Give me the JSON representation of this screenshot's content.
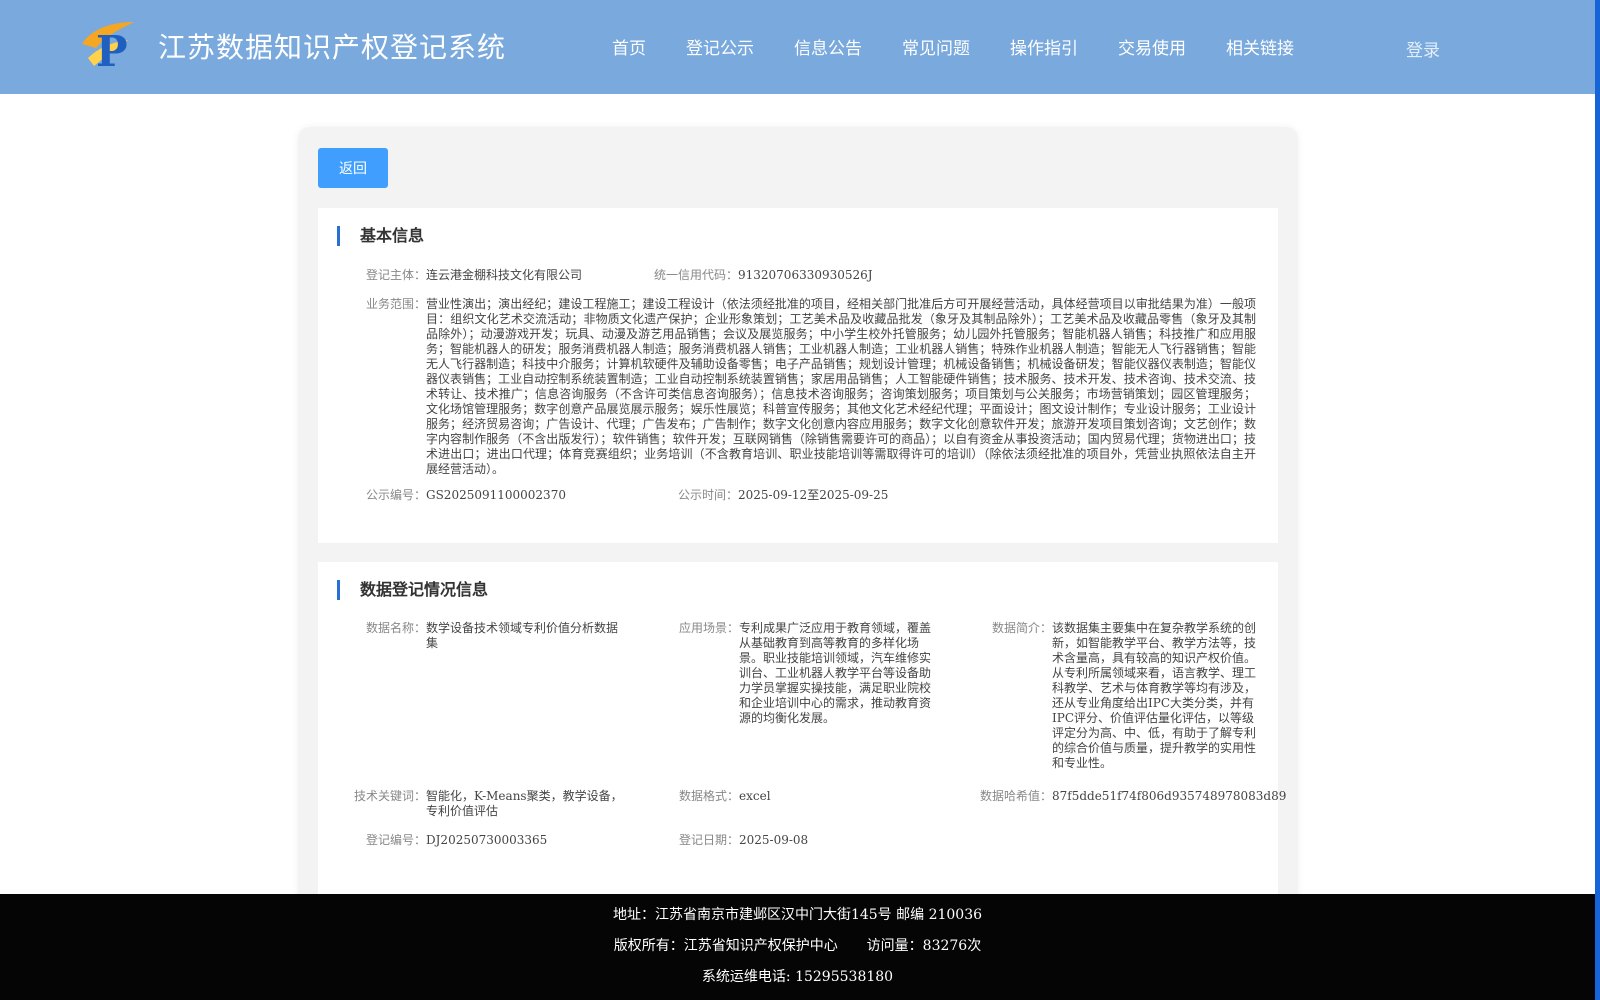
{
  "header": {
    "site_title": "江苏数据知识产权登记系统",
    "logo_icon": "ip-logo-icon",
    "nav": [
      "首页",
      "登记公示",
      "信息公告",
      "常见问题",
      "操作指引",
      "交易使用",
      "相关链接"
    ],
    "login_label": "登录"
  },
  "colors": {
    "header_bg": "#79a9dd",
    "primary_button": "#409eff",
    "section_accent": "#2a6fd6",
    "footer_bg": "#050505"
  },
  "main": {
    "back_label": "返回",
    "basic_info": {
      "title": "基本信息",
      "subject_label": "登记主体：",
      "subject_value": "连云港金棚科技文化有限公司",
      "credit_code_label": "统一信用代码：",
      "credit_code_value": "91320706330930526J",
      "scope_label": "业务范围：",
      "scope_value": "营业性演出；演出经纪；建设工程施工；建设工程设计（依法须经批准的项目，经相关部门批准后方可开展经营活动，具体经营项目以审批结果为准）一般项目：组织文化艺术交流活动；非物质文化遗产保护；企业形象策划；工艺美术品及收藏品批发（象牙及其制品除外）；工艺美术品及收藏品零售（象牙及其制品除外）；动漫游戏开发；玩具、动漫及游艺用品销售；会议及展览服务；中小学生校外托管服务；幼儿园外托管服务；智能机器人销售；科技推广和应用服务；智能机器人的研发；服务消费机器人制造；服务消费机器人销售；工业机器人制造；工业机器人销售；特殊作业机器人制造；智能无人飞行器销售；智能无人飞行器制造；科技中介服务；计算机软硬件及辅助设备零售；电子产品销售；规划设计管理；机械设备销售；机械设备研发；智能仪器仪表制造；智能仪器仪表销售；工业自动控制系统装置制造；工业自动控制系统装置销售；家居用品销售；人工智能硬件销售；技术服务、技术开发、技术咨询、技术交流、技术转让、技术推广；信息咨询服务（不含许可类信息咨询服务）；信息技术咨询服务；咨询策划服务；项目策划与公关服务；市场营销策划；园区管理服务；文化场馆管理服务；数字创意产品展览展示服务；娱乐性展览；科普宣传服务；其他文化艺术经纪代理；平面设计；图文设计制作；专业设计服务；工业设计服务；经济贸易咨询；广告设计、代理；广告发布；广告制作；数字文化创意内容应用服务；数字文化创意软件开发；旅游开发项目策划咨询；文艺创作；数字内容制作服务（不含出版发行）；软件销售；软件开发；互联网销售（除销售需要许可的商品）；以自有资金从事投资活动；国内贸易代理；货物进出口；技术进出口；进出口代理；体育竞赛组织；业务培训（不含教育培训、职业技能培训等需取得许可的培训）（除依法须经批准的项目外，凭营业执照依法自主开展经营活动）。",
      "notice_no_label": "公示编号：",
      "notice_no_value": "GS2025091100002370",
      "notice_time_label": "公示时间：",
      "notice_time_value": "2025-09-12至2025-09-25"
    },
    "data_info": {
      "title": "数据登记情况信息",
      "name_label": "数据名称：",
      "name_value": "数学设备技术领域专利价值分析数据集",
      "scene_label": "应用场景：",
      "scene_value": "专利成果广泛应用于教育领域，覆盖从基础教育到高等教育的多样化场景。职业技能培训领域，汽车维修实训台、工业机器人教学平台等设备助力学员掌握实操技能，满足职业院校和企业培训中心的需求，推动教育资源的均衡化发展。",
      "intro_label": "数据简介：",
      "intro_value": "该数据集主要集中在复杂教学系统的创新，如智能教学平台、教学方法等，技术含量高，具有较高的知识产权价值。从专利所属领域来看，语言教学、理工科教学、艺术与体育教学等均有涉及，还从专业角度给出IPC大类分类，并有IPC评分、价值评估量化评估，以等级评定分为高、中、低，有助于了解专利的综合价值与质量，提升教学的实用性和专业性。",
      "keywords_label": "技术关键词：",
      "keywords_value": "智能化，K-Means聚类，教学设备，专利价值评估",
      "format_label": "数据格式：",
      "format_value": "excel",
      "hash_label": "数据哈希值：",
      "hash_value": "87f5dde51f74f806d935748978083d89",
      "reg_no_label": "登记编号：",
      "reg_no_value": "DJ20250730003365",
      "reg_date_label": "登记日期：",
      "reg_date_value": "2025-09-08"
    }
  },
  "footer": {
    "address": "地址：江苏省南京市建邺区汉中门大街145号  邮编 210036",
    "copyright": "版权所有：江苏省知识产权保护中心",
    "visits": "访问量：83276次",
    "phone": "系统运维电话: 15295538180"
  }
}
